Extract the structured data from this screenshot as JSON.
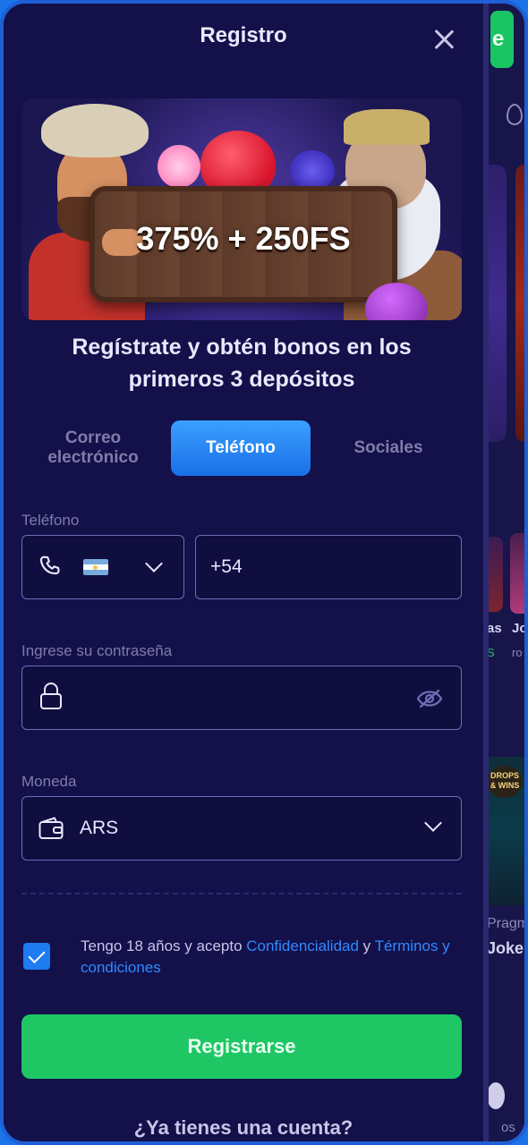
{
  "modal": {
    "title": "Registro",
    "banner_text": "375% + 250FS",
    "promo_text": "Regístrate y obtén bonos en los primeros 3 depósitos"
  },
  "tabs": [
    {
      "label": "Correo electrónico",
      "active": false
    },
    {
      "label": "Teléfono",
      "active": true
    },
    {
      "label": "Sociales",
      "active": false
    }
  ],
  "phone": {
    "label": "Teléfono",
    "country_flag": "argentina-flag",
    "value": "+54"
  },
  "password": {
    "label": "Ingrese su contraseña",
    "value": ""
  },
  "currency": {
    "label": "Moneda",
    "value": "ARS"
  },
  "terms": {
    "checked": true,
    "prefix": "Tengo 18 años y acepto ",
    "privacy_link": "Confidencialidad",
    "middle": " y ",
    "terms_link": "Términos y condiciones"
  },
  "register_button": "Registrarse",
  "account_prompt": "¿Ya tienes una cuenta?",
  "background_page": {
    "button_letter": "e",
    "game1_title": "as",
    "game1_sub": "S",
    "game2_title": "Jo",
    "game2_sub": "ro",
    "drops_badge": "DROPS & WINS",
    "provider": "Pragm",
    "game3_title": "Joke",
    "footer_label": "os"
  },
  "colors": {
    "accent_blue": "#1e7bf2",
    "register_green": "#1ec764",
    "modal_bg": "#13104a",
    "link_blue": "#2f8bff"
  }
}
